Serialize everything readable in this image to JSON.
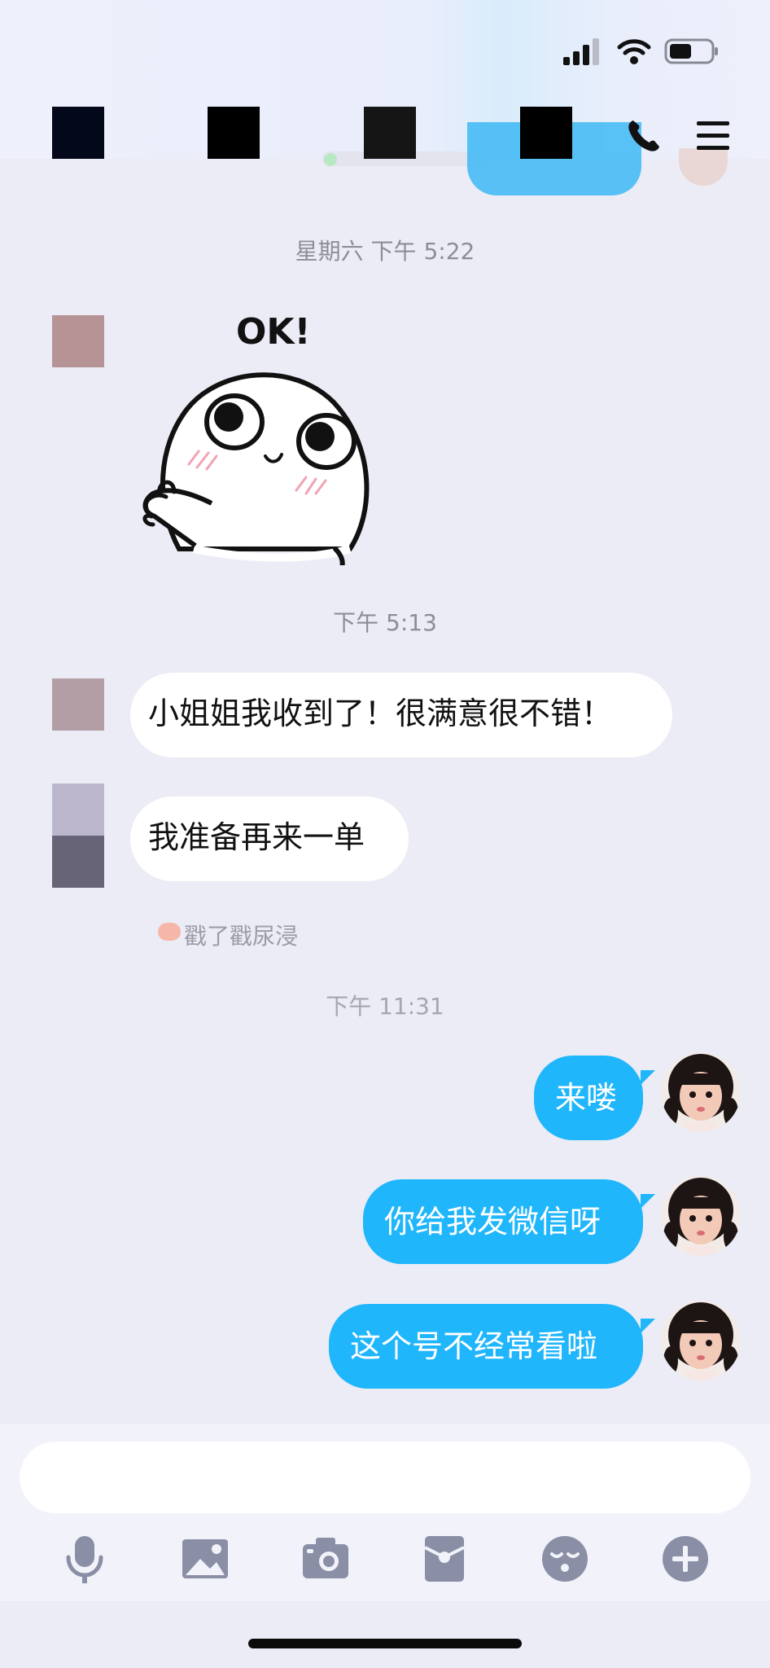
{
  "status_bar": {
    "signal_icon": "cellular-signal-icon",
    "wifi_icon": "wifi-icon",
    "battery_icon": "battery-icon"
  },
  "header": {
    "call_icon": "phone-icon",
    "menu_icon": "menu-icon"
  },
  "messages": {
    "ts1": "星期六 下午 5:22",
    "ts2": "下午 5:13",
    "ts3": "下午 11:31",
    "sticker_text": "OK!",
    "in1": "小姐姐我收到了！很满意很不错！",
    "in2": "我准备再来一单",
    "poke_text": "戳了戳尿浸",
    "out1": "来喽",
    "out2": "你给我发微信呀",
    "out3": "这个号不经常看啦"
  },
  "input": {
    "placeholder": ""
  },
  "toolbar": {
    "icons": [
      "microphone-icon",
      "image-icon",
      "camera-icon",
      "red-packet-icon",
      "emoji-icon",
      "plus-icon"
    ]
  },
  "colors": {
    "accent": "#20b6fb",
    "background": "#ececf6",
    "incoming_bubble": "#ffffff"
  }
}
